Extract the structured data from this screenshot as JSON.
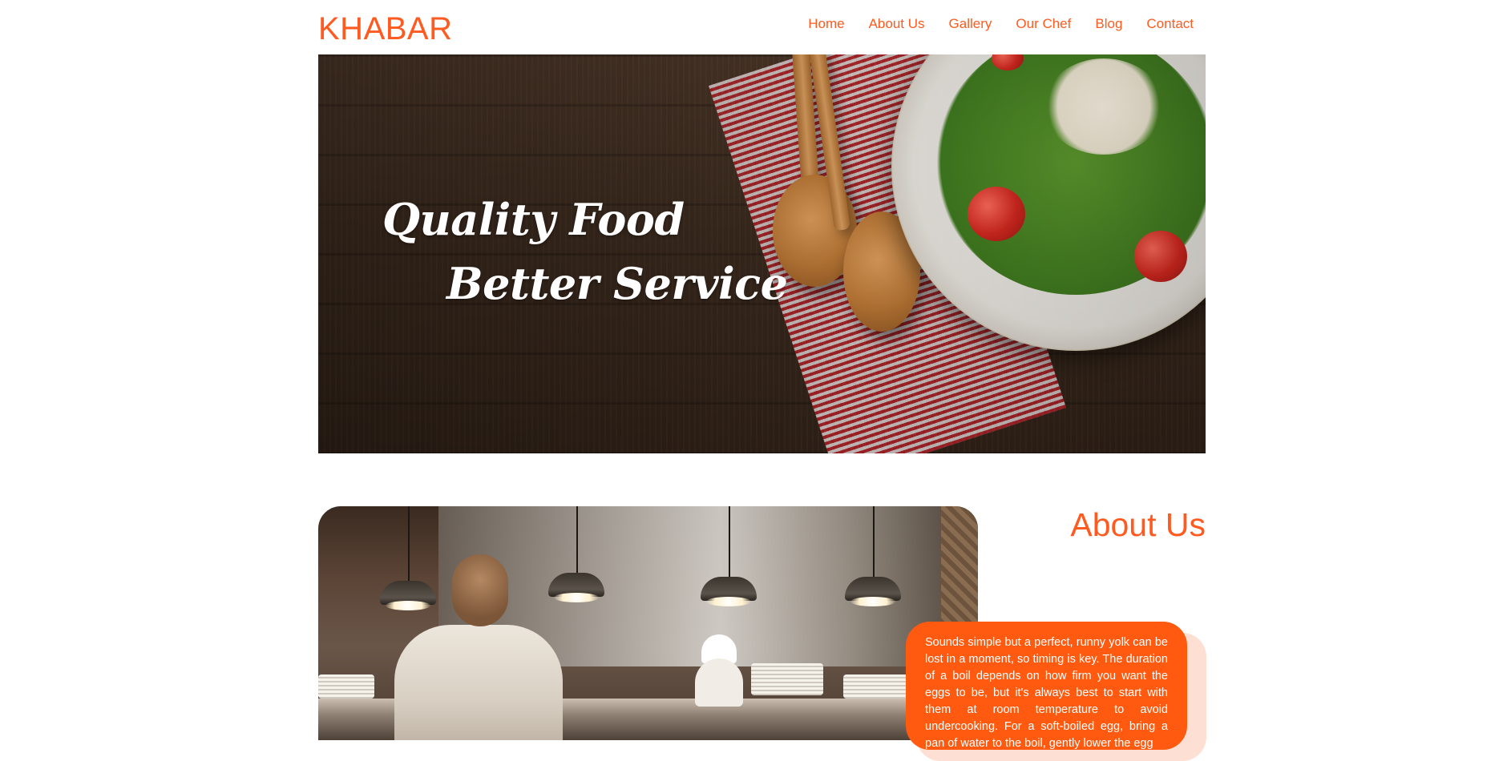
{
  "header": {
    "logo": "KHABAR",
    "nav": [
      "Home",
      "About Us",
      "Gallery",
      "Our Chef",
      "Blog",
      "Contact"
    ]
  },
  "hero": {
    "line1": "Quality Food",
    "line2": "Better Service"
  },
  "about": {
    "title": "About Us",
    "text": "Sounds simple but a perfect, runny yolk can be lost in a moment, so timing is key. The duration of a boil depends on how firm you want the eggs to be, but it's always best to start with them at room temperature to avoid undercooking. For a soft-boiled egg, bring a pan of water to the boil, gently lower the egg"
  },
  "colors": {
    "accent": "#ff5a1f",
    "card": "#ff5a0f",
    "card_shadow": "#fde0d3"
  }
}
